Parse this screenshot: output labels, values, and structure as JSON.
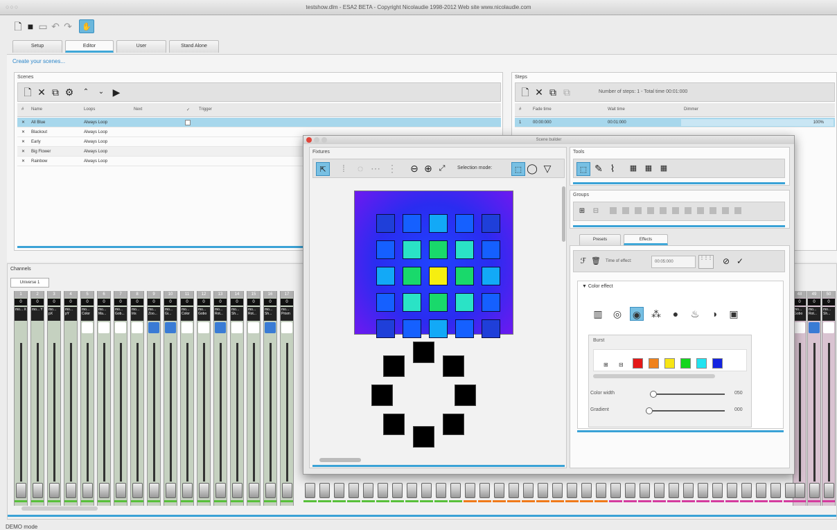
{
  "window": {
    "title": "testshow.dlm - ESA2 BETA - Copyright Nicolaudie 1998-2012 Web site www.nicolaudie.com"
  },
  "tabs": [
    "Setup",
    "Editor",
    "User",
    "Stand Alone"
  ],
  "breadcrumb": "Create your scenes...",
  "scenes": {
    "header": "Scenes",
    "columns": [
      "#",
      "Name",
      "Loops",
      "Next",
      "✓",
      "Trigger"
    ],
    "rows": [
      {
        "name": "All Blue",
        "loops": "Always Loop"
      },
      {
        "name": "Blackout",
        "loops": "Always Loop"
      },
      {
        "name": "Early",
        "loops": "Always Loop"
      },
      {
        "name": "Big Flower",
        "loops": "Always Loop"
      },
      {
        "name": "Rainbow",
        "loops": "Always Loop"
      }
    ],
    "row_mark": "✕"
  },
  "steps": {
    "header": "Steps",
    "info": "Number of steps: 1 - Total time 00:01:000",
    "columns": [
      "#",
      "Fade time",
      "Wait time",
      "Dimmer"
    ],
    "row": {
      "num": "1",
      "fade": "00:00:000",
      "wait": "00:01:000",
      "dimmer": "100%"
    }
  },
  "channels": {
    "header": "Channels",
    "universe_tab": "Universe 1",
    "left_numbers": [
      "1",
      "2",
      "3",
      "4",
      "5",
      "6",
      "7",
      "8",
      "9",
      "10",
      "11",
      "12",
      "13",
      "14",
      "15",
      "16",
      "17"
    ],
    "left_values": [
      "0",
      "0",
      "0",
      "0",
      "0",
      "0",
      "0",
      "0",
      "0",
      "0",
      "0",
      "0",
      "0",
      "0",
      "0",
      "0",
      "0"
    ],
    "left_names": [
      "mo... X",
      "mo... Y",
      "mo... pX",
      "mo... pY",
      "mo... Color",
      "mo... Ma...",
      "mo... Gob...",
      "mo... Iris",
      "mo... Zoo...",
      "mo... Gi...",
      "mo... Color",
      "mo... Gobo",
      "mo... Rot...",
      "mo... Sh...",
      "mo... Rot...",
      "mo... Sh...",
      "mo... Prism"
    ],
    "right_numbers": [
      "48",
      "49",
      "50"
    ],
    "right_values": [
      "0",
      "0",
      "0"
    ],
    "right_names": [
      "mo... Gobo",
      "mo... Rot...",
      "mo... Sh..."
    ]
  },
  "scene_builder": {
    "title": "Scene builder",
    "fixtures_header": "Fixtures",
    "selection_label": "Selection mode:",
    "tools_header": "Tools",
    "groups_header": "Groups",
    "tabs": [
      "Presets",
      "Effects"
    ],
    "time_label": "Time of effect:",
    "time_value": "00:05:000",
    "color_effect_header": "Color effect",
    "burst_label": "Burst",
    "burst_colors": [
      "#e41818",
      "#f0821c",
      "#f7e514",
      "#14d61e",
      "#21e3f0",
      "#1424e0"
    ],
    "color_width_label": "Color width",
    "color_width_value": "050",
    "gradient_label": "Gradient",
    "gradient_value": "000"
  },
  "status": "DEMO mode"
}
